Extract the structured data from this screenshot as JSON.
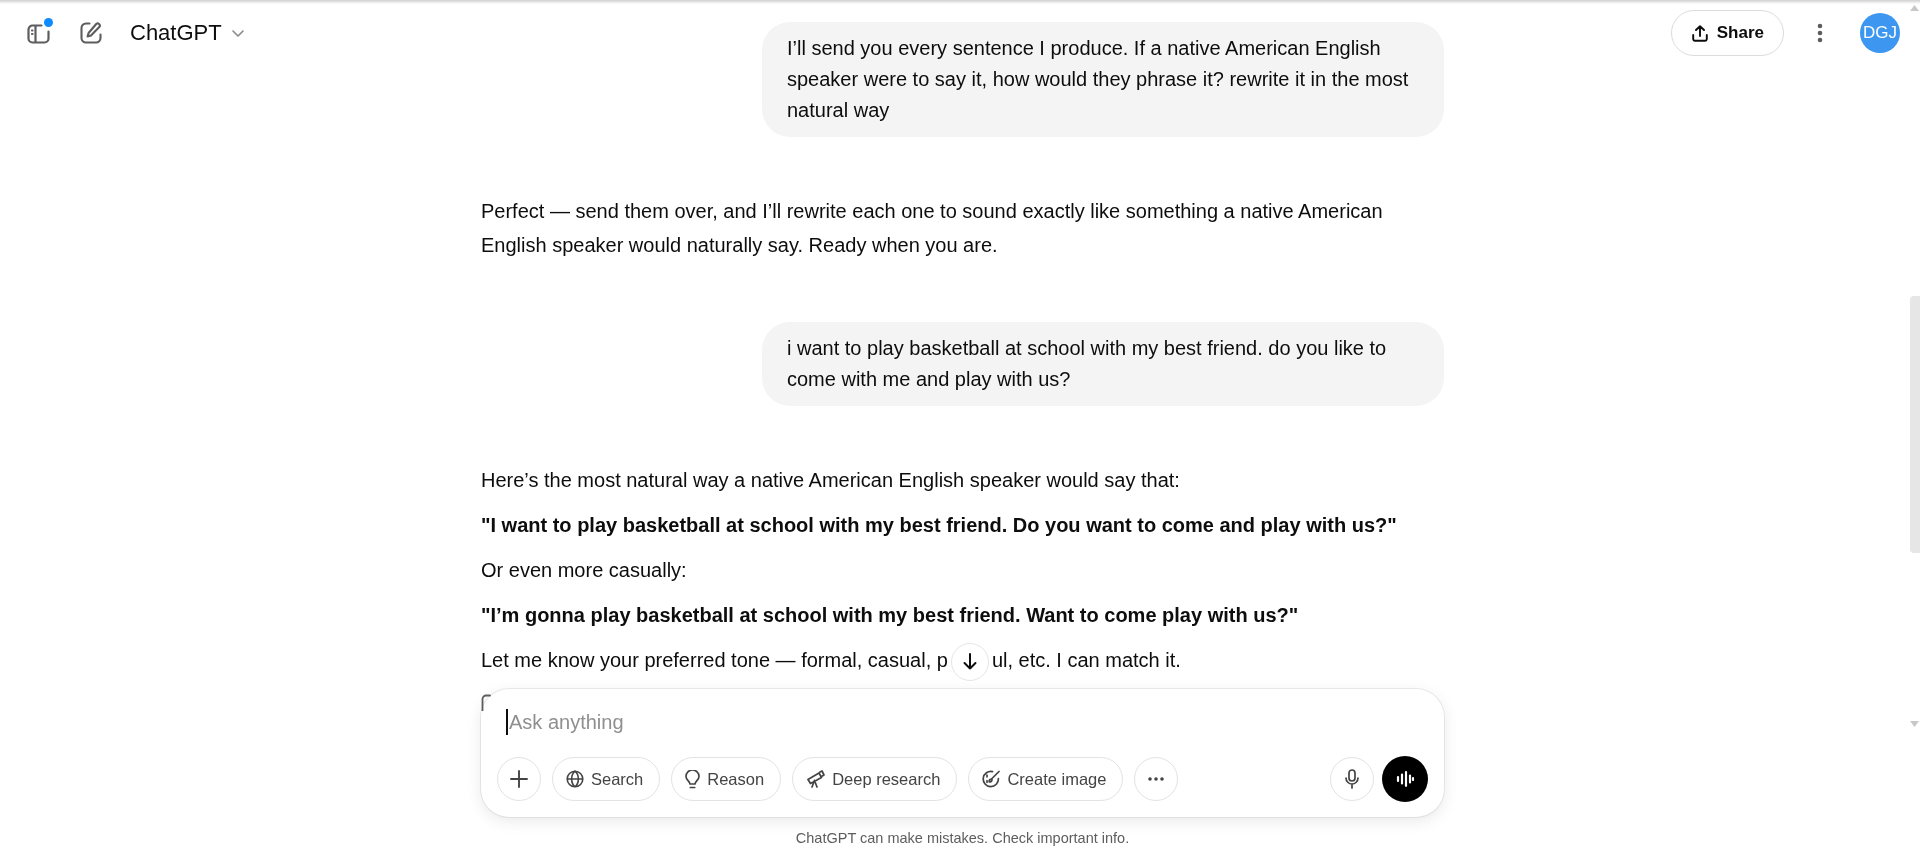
{
  "header": {
    "title": "ChatGPT",
    "notification_dot": true,
    "share_label": "Share",
    "avatar_initials": "DGJ"
  },
  "messages": [
    {
      "kind": "user",
      "text": "I’ll send you every sentence I produce. If a native American English speaker were to say it, how would they phrase it? rewrite it in the most natural way"
    },
    {
      "kind": "assistant",
      "paragraphs": [
        {
          "text": "Perfect — send them over, and I’ll rewrite each one to sound exactly like something a native American English speaker would naturally say. Ready when you are.",
          "bold": false
        }
      ]
    },
    {
      "kind": "user",
      "text": "i want to play basketball at school with my best friend. do you like to come with me and play with us?"
    },
    {
      "kind": "assistant",
      "paragraphs": [
        {
          "text": "Here’s the most natural way a native American English speaker would say that:",
          "bold": false
        },
        {
          "text": "\"I want to play basketball at school with my best friend. Do you want to come and play with us?\"",
          "bold": true
        },
        {
          "text": "Or even more casually:",
          "bold": false
        },
        {
          "text": "\"I’m gonna play basketball at school with my best friend. Want to come play with us?\"",
          "bold": true
        },
        {
          "parts": [
            "Let me know your preferred tone — formal, casual, p",
            "ul, etc. I can match it."
          ],
          "bold": false
        }
      ]
    }
  ],
  "composer": {
    "placeholder": "Ask anything",
    "focused": true,
    "tools": [
      {
        "kind": "search",
        "label": "Search"
      },
      {
        "kind": "reason",
        "label": "Reason"
      },
      {
        "kind": "research",
        "label": "Deep research"
      },
      {
        "kind": "image",
        "label": "Create image"
      }
    ]
  },
  "footer_note": "ChatGPT can make mistakes. Check important info."
}
